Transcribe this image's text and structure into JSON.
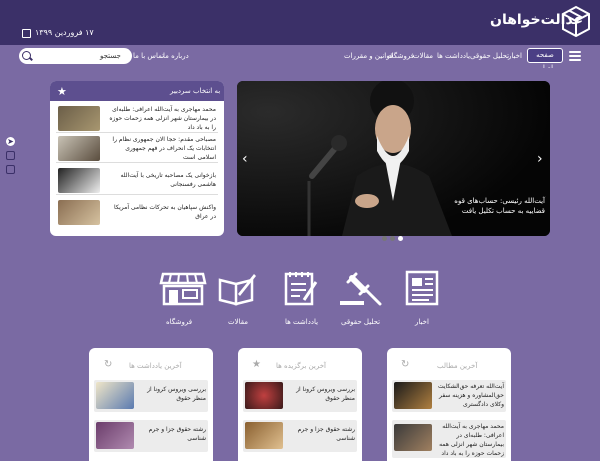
{
  "header": {
    "logo_text": "عدالت‌خواهان",
    "date": "۱۷ فروردین ۱۳۹۹"
  },
  "nav": {
    "home": "صفحه اصلی",
    "items": [
      "اخبار",
      "تحلیل حقوقی",
      "یادداشت ها",
      "مقالات",
      "فروشگاه",
      "قوانین و مقررات"
    ],
    "items_left": [
      "درباره ما",
      "تماس با ما"
    ],
    "search_placeholder": "جستجو"
  },
  "editor_picks": {
    "title": "به انتخاب سردبیر",
    "items": [
      {
        "text": "محمد مهاجری به آیت‌الله اعرافی: طلبه‌ای در بیمارستان شهر انزلی همه زحمات حوزه را به باد داد"
      },
      {
        "text": "مصباحی مقدم: حجا الا‌ن جمهوری نظام را انتخابات یک انحراف در فهم جمهوری اسلامی است"
      },
      {
        "text": "بازخوانی یک مصاحبه تاریخی با آیت‌الله هاشمی رفسنجانی"
      },
      {
        "text": "واکنش سپاهیان به تحرکات نظامی آمریکا در عراق"
      }
    ]
  },
  "slider": {
    "caption": "آیت‌الله رئیسی: حساب‌های قوه قضاییه به حساب تکلیل یافت",
    "slides": 3,
    "active": 3
  },
  "categories": [
    {
      "label": "اخبار",
      "icon": "newspaper-icon"
    },
    {
      "label": "تحلیل حقوقی",
      "icon": "gavel-icon"
    },
    {
      "label": "یادداشت ها",
      "icon": "notepad-icon"
    },
    {
      "label": "مقالات",
      "icon": "book-icon"
    },
    {
      "label": "فروشگاه",
      "icon": "shop-icon"
    }
  ],
  "cards": {
    "notes": {
      "title": "آخرین یادداشت ها",
      "items": [
        {
          "text": "بررسی ویروس کرونا از منظر حقوق"
        },
        {
          "text": "رشته حقوق جزا و جرم شناسی"
        }
      ]
    },
    "featured": {
      "title": "آخرین برگزیده ها",
      "items": [
        {
          "text": "بررسی ویروس کرونا از منظر حقوق"
        },
        {
          "text": "رشته حقوق جزا و جرم شناسی"
        }
      ]
    },
    "latest": {
      "title": "آخرین مطالب",
      "items": [
        {
          "text": "آیت‌الله تعرفه حق‌الشکایت حق‌المشاوره و هزینه سفر وکلای دادگستری"
        },
        {
          "text": "محمد مهاجری به آیت‌الله اعرافی: طلبه‌ای در بیمارستان شهر انزلی همه زحمات حوزه را به باد داد"
        }
      ]
    }
  },
  "colors": {
    "header": "#3b3068",
    "band": "#7a6aa3"
  }
}
